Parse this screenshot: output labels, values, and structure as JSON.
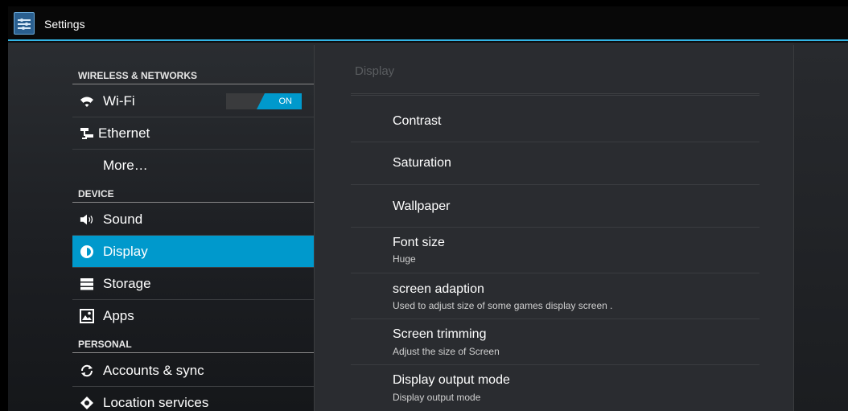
{
  "app": {
    "title": "Settings"
  },
  "sidebar": {
    "sections": [
      {
        "header": "WIRELESS & NETWORKS"
      },
      {
        "header": "DEVICE"
      },
      {
        "header": "PERSONAL"
      }
    ],
    "items": [
      {
        "label": "Wi-Fi",
        "icon": "wifi-icon",
        "toggle": "ON"
      },
      {
        "label": "Ethernet",
        "icon": "ethernet-icon"
      },
      {
        "label": "More…"
      },
      {
        "label": "Sound",
        "icon": "sound-icon"
      },
      {
        "label": "Display",
        "icon": "display-icon",
        "selected": true
      },
      {
        "label": "Storage",
        "icon": "storage-icon"
      },
      {
        "label": "Apps",
        "icon": "apps-icon"
      },
      {
        "label": "Accounts & sync",
        "icon": "sync-icon"
      },
      {
        "label": "Location services",
        "icon": "location-icon"
      }
    ]
  },
  "detail": {
    "title": "Display",
    "prefs": [
      {
        "title": "Contrast"
      },
      {
        "title": "Saturation"
      },
      {
        "title": "Wallpaper"
      },
      {
        "title": "Font size",
        "summary": "Huge"
      },
      {
        "title": "screen adaption",
        "summary": "Used to adjust size of some games display screen ."
      },
      {
        "title": "Screen trimming",
        "summary": "Adjust the size of Screen"
      },
      {
        "title": "Display output mode",
        "summary": "Display output mode"
      }
    ]
  },
  "colors": {
    "accent": "#33b5e5",
    "selected": "#0099cc"
  }
}
